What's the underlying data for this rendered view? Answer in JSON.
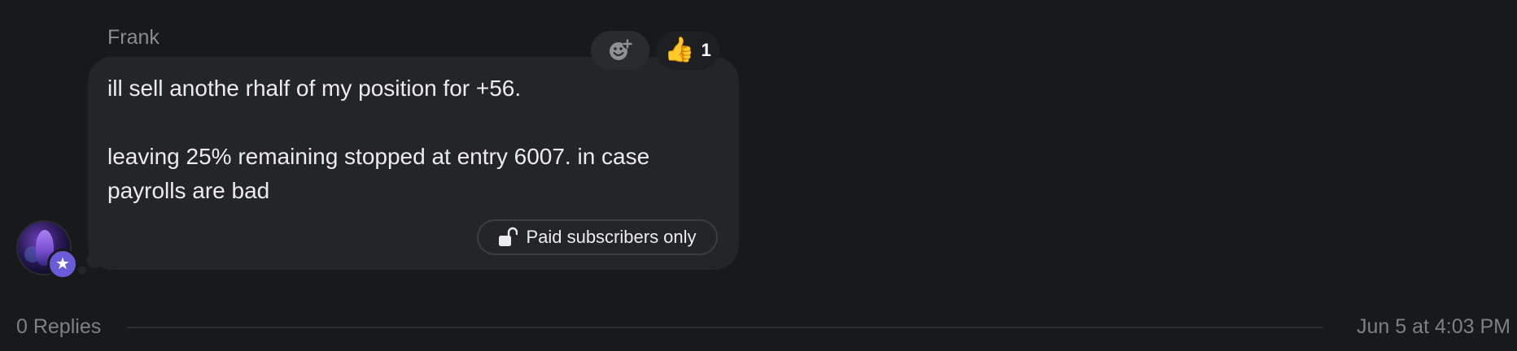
{
  "message": {
    "sender": "Frank",
    "paragraphs": [
      "ill sell anothe rhalf of my position for +56.",
      "leaving 25% remaining stopped at entry 6007. in case payrolls are bad"
    ],
    "paid_badge": "Paid subscribers only"
  },
  "reactions": {
    "add_icon": "add-reaction-icon",
    "thumbs_up": {
      "emoji": "👍",
      "count": "1"
    }
  },
  "footer": {
    "replies": "0 Replies",
    "timestamp": "Jun 5 at 4:03 PM"
  },
  "colors": {
    "background": "#18191b",
    "bubble": "#242527",
    "badge_accent": "#6a5cd8",
    "text": "#ececee",
    "muted": "#7e8085"
  }
}
